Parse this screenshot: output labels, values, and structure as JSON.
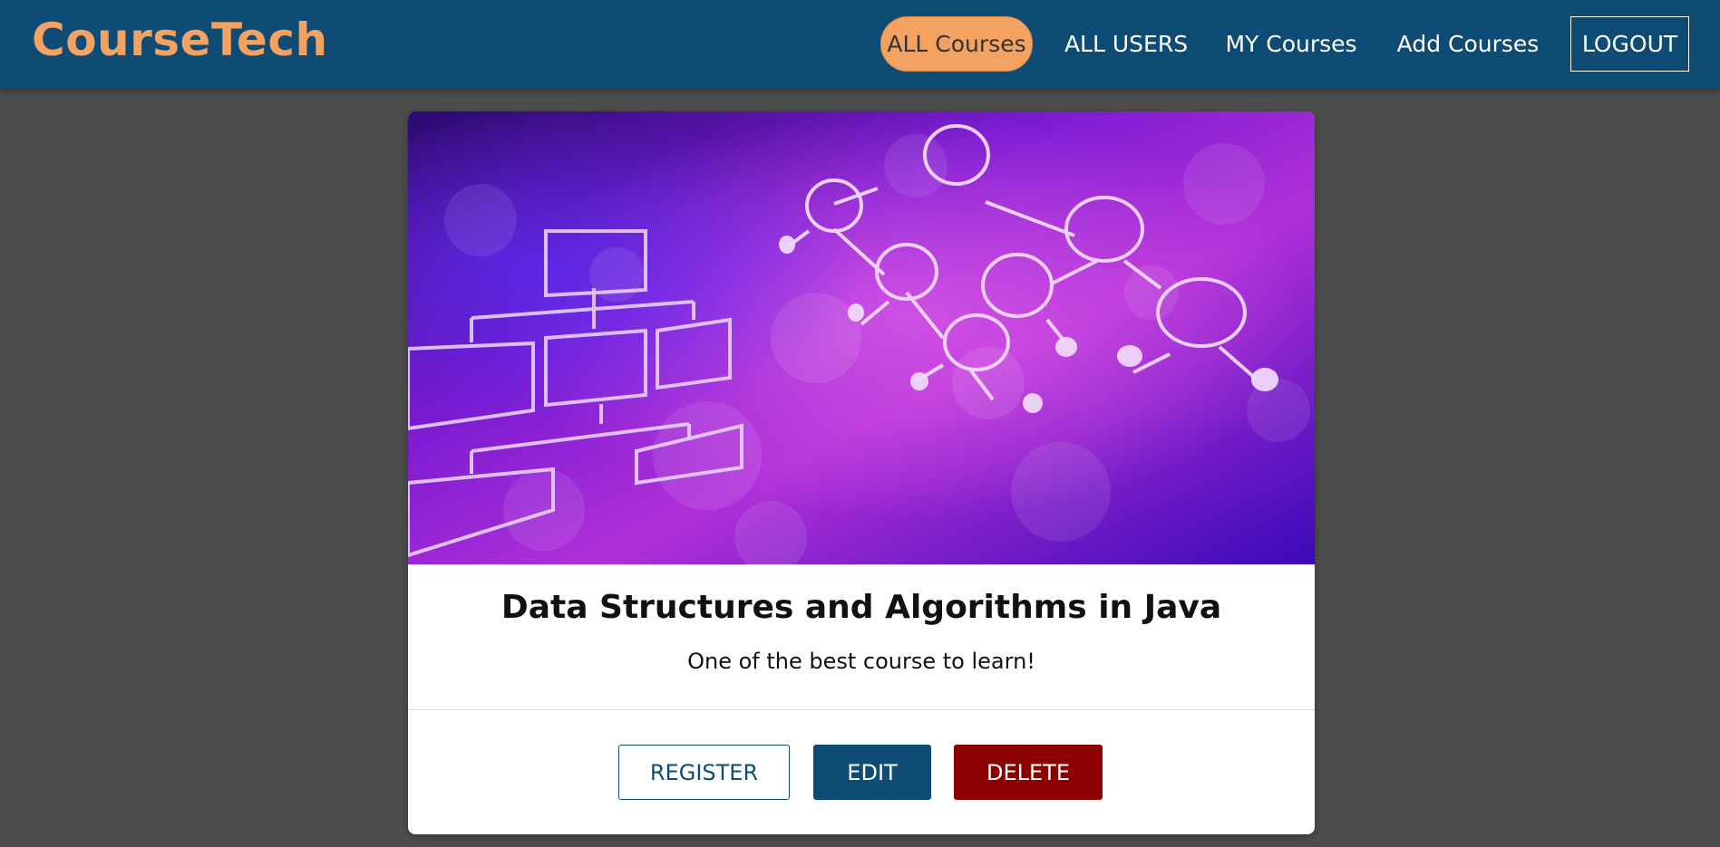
{
  "brand": "CourseTech",
  "nav": {
    "all_courses": "ALL Courses",
    "all_users": "ALL USERS",
    "my_courses": "MY Courses",
    "add_courses": "Add Courses",
    "logout": "LOGOUT"
  },
  "course": {
    "title": "Data Structures and Algorithms in Java",
    "description": "One of the best course to learn!",
    "image_icon": "data-structure-tree-illustration"
  },
  "actions": {
    "register": "REGISTER",
    "edit": "EDIT",
    "delete": "DELETE"
  },
  "colors": {
    "header": "#0f4c75",
    "accent": "#f4a261",
    "page_background": "#4d4d4d",
    "delete": "#8b0000"
  }
}
